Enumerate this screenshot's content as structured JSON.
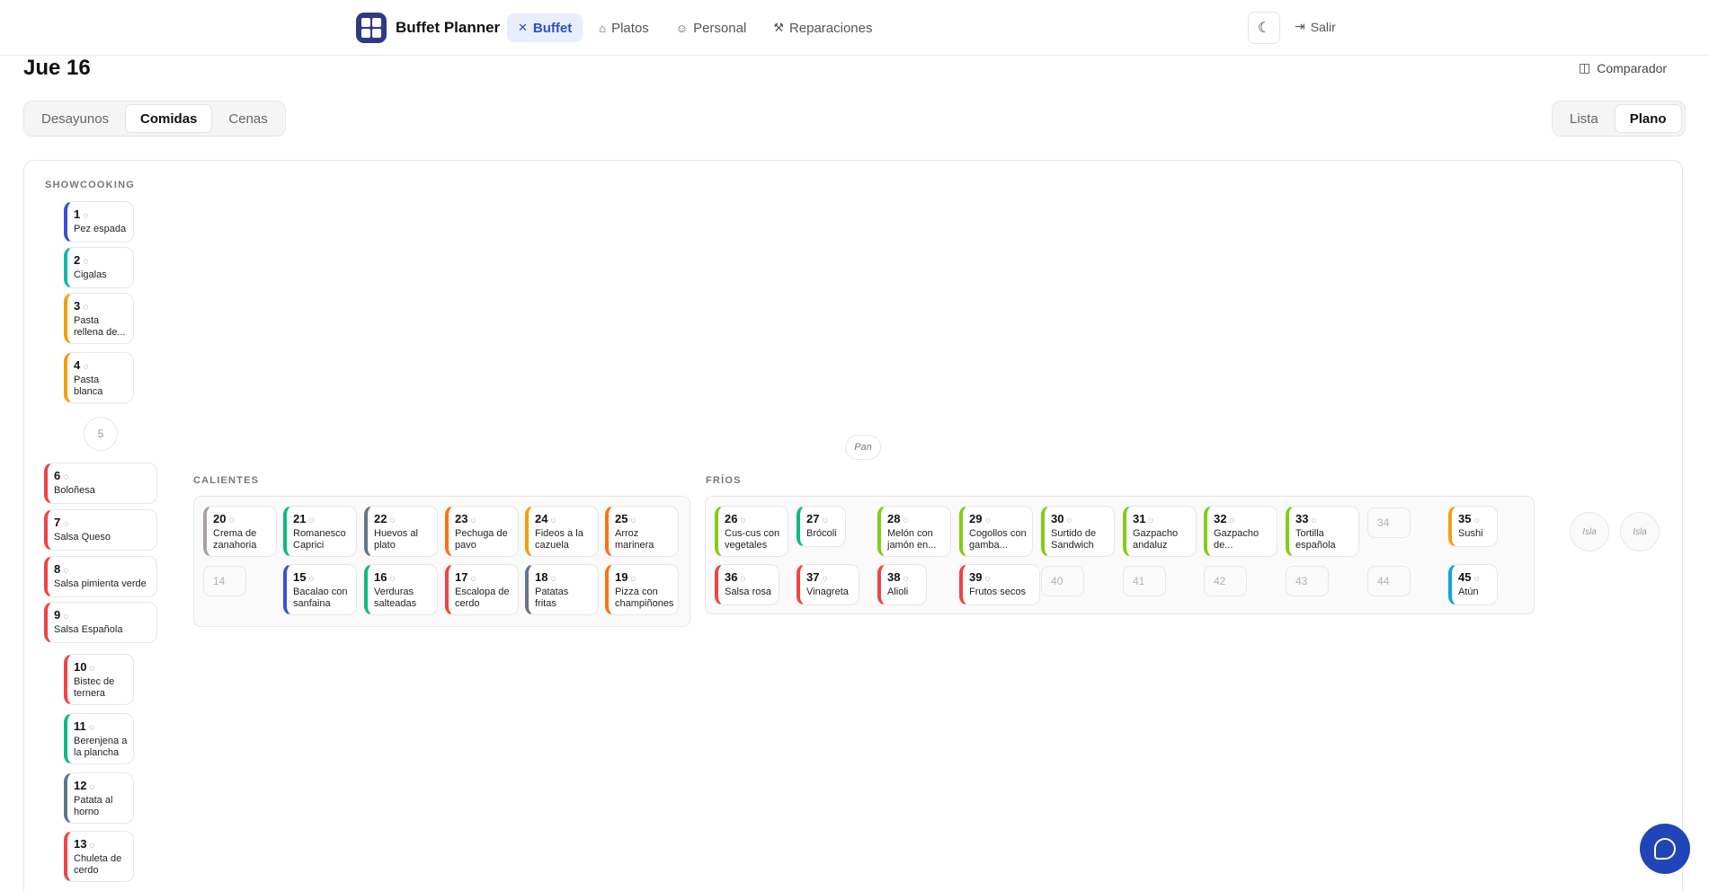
{
  "app": {
    "name": "Buffet Planner"
  },
  "nav": {
    "tabs": [
      {
        "label": "Buffet",
        "icon": "utensils-icon",
        "active": true
      },
      {
        "label": "Platos",
        "icon": "chef-hat-icon",
        "active": false
      },
      {
        "label": "Personal",
        "icon": "users-icon",
        "active": false
      },
      {
        "label": "Reparaciones",
        "icon": "wrench-icon",
        "active": false
      }
    ],
    "theme_icon": "moon-icon",
    "logout_label": "Salir"
  },
  "header": {
    "day": "Jue 16",
    "comparador_label": "Comparador",
    "meals": [
      "Desayunos",
      "Comidas",
      "Cenas"
    ],
    "active_meal": "Comidas",
    "views": [
      "Lista",
      "Plano"
    ],
    "active_view": "Plano"
  },
  "plan": {
    "showcooking_label": "SHOWCOOKING",
    "calientes_label": "CALIENTES",
    "frios_label": "FRÍOS",
    "pan_label": "Pan",
    "isla_labels": [
      "Isla",
      "Isla"
    ],
    "empty_slots": [
      "5",
      "14",
      "34",
      "40",
      "41",
      "42",
      "43",
      "44"
    ],
    "dishes": [
      {
        "num": "1",
        "name": "Pez espada",
        "color": "#3b4fd8"
      },
      {
        "num": "2",
        "name": "Cigalas",
        "color": "#14b8a6"
      },
      {
        "num": "3",
        "name": "Pasta rellena de...",
        "color": "#f59e0b"
      },
      {
        "num": "4",
        "name": "Pasta blanca",
        "color": "#f59e0b"
      },
      {
        "num": "6",
        "name": "Boloñesa",
        "color": "#ef4444"
      },
      {
        "num": "7",
        "name": "Salsa Queso",
        "color": "#ef4444"
      },
      {
        "num": "8",
        "name": "Salsa pimienta verde",
        "color": "#ef4444"
      },
      {
        "num": "9",
        "name": "Salsa Española",
        "color": "#ef4444"
      },
      {
        "num": "10",
        "name": "Bistec de ternera",
        "color": "#ef4444"
      },
      {
        "num": "11",
        "name": "Berenjena a la plancha",
        "color": "#10b981"
      },
      {
        "num": "12",
        "name": "Patata al horno",
        "color": "#64748b"
      },
      {
        "num": "13",
        "name": "Chuleta de cerdo",
        "color": "#ef4444"
      },
      {
        "num": "15",
        "name": "Bacalao con sanfaina",
        "color": "#3b4fd8"
      },
      {
        "num": "16",
        "name": "Verduras salteadas",
        "color": "#10b981"
      },
      {
        "num": "17",
        "name": "Escalopa de cerdo",
        "color": "#ef4444"
      },
      {
        "num": "18",
        "name": "Patatas fritas",
        "color": "#64748b"
      },
      {
        "num": "19",
        "name": "Pizza con champiñones",
        "color": "#f97316"
      },
      {
        "num": "20",
        "name": "Crema de zanahoria",
        "color": "#a8a29e"
      },
      {
        "num": "21",
        "name": "Romanesco Caprici",
        "color": "#10b981"
      },
      {
        "num": "22",
        "name": "Huevos al plato",
        "color": "#64748b"
      },
      {
        "num": "23",
        "name": "Pechuga de pavo",
        "color": "#f97316"
      },
      {
        "num": "24",
        "name": "Fideos a la cazuela",
        "color": "#f59e0b"
      },
      {
        "num": "25",
        "name": "Arroz marinera",
        "color": "#f97316"
      },
      {
        "num": "26",
        "name": "Cus-cus con vegetales",
        "color": "#84cc16"
      },
      {
        "num": "27",
        "name": "Brócoli",
        "color": "#10b981"
      },
      {
        "num": "28",
        "name": "Melón con jamón en...",
        "color": "#84cc16"
      },
      {
        "num": "29",
        "name": "Cogollos con gamba...",
        "color": "#84cc16"
      },
      {
        "num": "30",
        "name": "Surtido de Sandwich",
        "color": "#84cc16"
      },
      {
        "num": "31",
        "name": "Gazpacho andaluz",
        "color": "#84cc16"
      },
      {
        "num": "32",
        "name": "Gazpacho de...",
        "color": "#84cc16"
      },
      {
        "num": "33",
        "name": "Tortilla española",
        "color": "#84cc16"
      },
      {
        "num": "35",
        "name": "Sushi",
        "color": "#f59e0b"
      },
      {
        "num": "36",
        "name": "Salsa rosa",
        "color": "#ef4444"
      },
      {
        "num": "37",
        "name": "Vinagreta",
        "color": "#ef4444"
      },
      {
        "num": "38",
        "name": "Alioli",
        "color": "#ef4444"
      },
      {
        "num": "39",
        "name": "Frutos secos",
        "color": "#ef4444"
      },
      {
        "num": "45",
        "name": "Atún",
        "color": "#0ea5e9"
      }
    ]
  },
  "chat_icon": "chat-bubble-icon"
}
